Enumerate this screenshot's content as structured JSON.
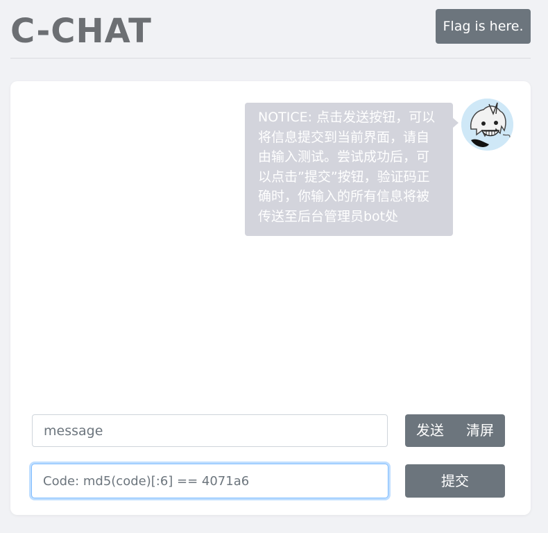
{
  "header": {
    "title": "C-CHAT",
    "flag_button_label": "Flag is here."
  },
  "chat": {
    "messages": [
      {
        "text": "NOTICE: 点击发送按钮，可以将信息提交到当前界面，请自由输入测试。尝试成功后，可以点击”提交”按钮，验证码正确时，你输入的所有信息将被传送至后台管理员bot处",
        "avatar": "anime-character-avatar"
      }
    ]
  },
  "composer": {
    "message_placeholder": "message",
    "send_label": "发送",
    "clear_label": "清屏",
    "code_placeholder": "Code: md5(code)[:6] == 4071a6",
    "submit_label": "提交"
  },
  "colors": {
    "page_bg": "#f1f2f5",
    "button_gray": "#6c757d",
    "bubble_bg": "#d3d4dc",
    "title_gray": "#6c6f73",
    "focus_blue": "#80bdff"
  }
}
